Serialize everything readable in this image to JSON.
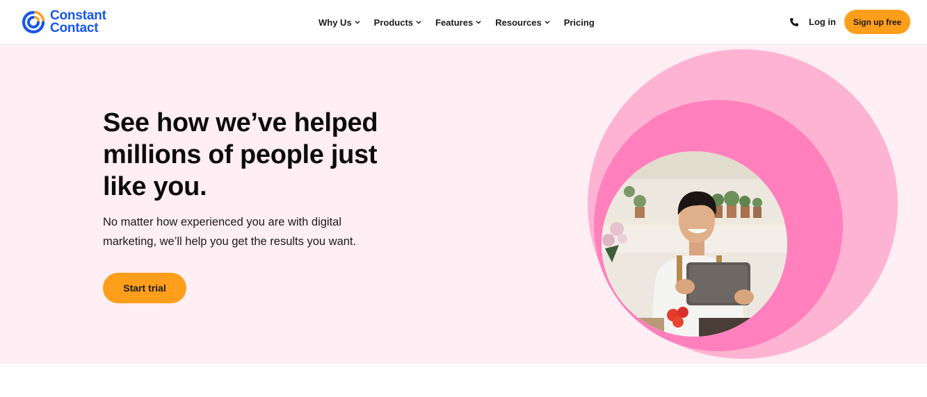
{
  "brand": {
    "name_line1": "Constant",
    "name_line2": "Contact",
    "logo_icon": "constant-contact-logo-icon",
    "primary_color": "#1856ed",
    "accent_color": "#ff9e1b"
  },
  "nav": {
    "items": [
      {
        "label": "Why Us",
        "has_dropdown": true
      },
      {
        "label": "Products",
        "has_dropdown": true
      },
      {
        "label": "Features",
        "has_dropdown": true
      },
      {
        "label": "Resources",
        "has_dropdown": true
      },
      {
        "label": "Pricing",
        "has_dropdown": false
      }
    ]
  },
  "header_actions": {
    "phone_icon": "phone-icon",
    "login_label": "Log in",
    "signup_label": "Sign up free"
  },
  "hero": {
    "title": "See how we’ve helped millions of people just like you.",
    "subtitle": "No matter how experienced you are with digital marketing, we’ll help you get the results you want.",
    "cta_label": "Start trial",
    "background_color": "#ffeef3",
    "circle_colors": [
      "#ffb3d2",
      "#ff80bd"
    ],
    "image_description": "Smiling man in apron holding a tablet in a flower shop"
  }
}
